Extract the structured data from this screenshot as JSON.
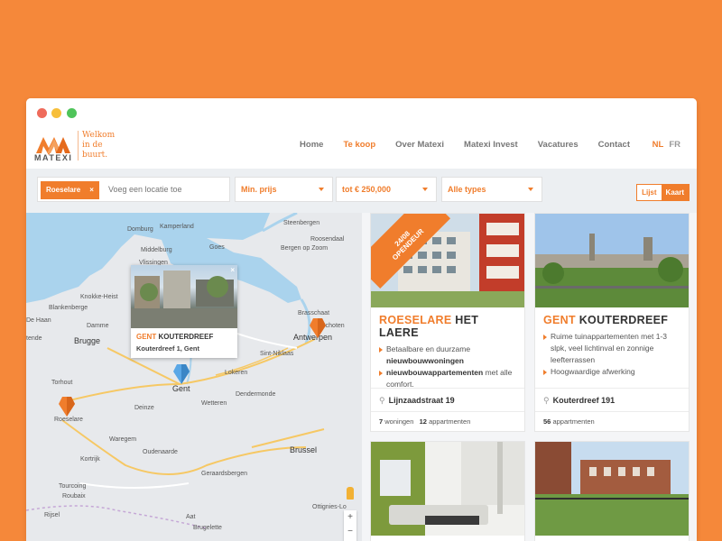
{
  "brand": {
    "name": "MATEXI",
    "tagline": "Welkom in de buurt.",
    "accent": "#f07d2c",
    "background": "#f5883a"
  },
  "nav": {
    "items": [
      {
        "label": "Home"
      },
      {
        "label": "Te koop"
      },
      {
        "label": "Over Matexi"
      },
      {
        "label": "Matexi Invest"
      },
      {
        "label": "Vacatures"
      },
      {
        "label": "Contact"
      }
    ],
    "active": "Te koop",
    "lang_nl": "NL",
    "lang_fr": "FR"
  },
  "filters": {
    "chip_label": "Roeselare",
    "chip_remove": "×",
    "search_placeholder": "Voeg een locatie toe",
    "min_price": "Min. prijs",
    "max_price": "tot € 250,000",
    "types": "Alle types",
    "view_list": "Lijst",
    "view_map": "Kaart"
  },
  "map": {
    "cities": [
      {
        "name": "Domburg"
      },
      {
        "name": "Kamperland"
      },
      {
        "name": "Middelburg"
      },
      {
        "name": "Goes"
      },
      {
        "name": "Steenbergen"
      },
      {
        "name": "Roosendaal"
      },
      {
        "name": "Vlissingen"
      },
      {
        "name": "Bergen op Zoom"
      },
      {
        "name": "Knokke-Heist"
      },
      {
        "name": "Blankenberge"
      },
      {
        "name": "De Haan"
      },
      {
        "name": "Damme"
      },
      {
        "name": "tende"
      },
      {
        "name": "Brugge"
      },
      {
        "name": "Sint-Niklaas"
      },
      {
        "name": "Brasschaat"
      },
      {
        "name": "Schoten"
      },
      {
        "name": "Antwerpen"
      },
      {
        "name": "Lokeren"
      },
      {
        "name": "Torhout"
      },
      {
        "name": "Gent"
      },
      {
        "name": "Dendermonde"
      },
      {
        "name": "Roeselare"
      },
      {
        "name": "Deinze"
      },
      {
        "name": "Wetteren"
      },
      {
        "name": "Waregem"
      },
      {
        "name": "Oudenaarde"
      },
      {
        "name": "Kortrijk"
      },
      {
        "name": "Brussel"
      },
      {
        "name": "Geraardsbergen"
      },
      {
        "name": "Tourcoing"
      },
      {
        "name": "Roubaix"
      },
      {
        "name": "Rijsel"
      },
      {
        "name": "Aat"
      },
      {
        "name": "Brugelette"
      },
      {
        "name": "Ottignies-Lo"
      }
    ],
    "popup": {
      "city": "GENT",
      "name": "KOUTERDREEF",
      "address": "Kouterdreef 1, Gent",
      "close": "×"
    },
    "zoom_in": "+",
    "zoom_out": "−"
  },
  "listings": [
    {
      "city": "ROESELARE",
      "name": "HET LAERE",
      "ribbon": "24/08 OPENDEUR",
      "bullets": [
        {
          "pre": "Betaalbare en duurzame ",
          "bold": "nieuwbouwwoningen",
          "post": ""
        },
        {
          "pre": "",
          "bold": "nieuwbouwappartementen",
          "post": " met alle comfort."
        }
      ],
      "address": "Lijnzaadstraat 19",
      "stat1_num": "7",
      "stat1_label": "woningen",
      "stat2_num": "12",
      "stat2_label": "appartmenten"
    },
    {
      "city": "GENT",
      "name": "KOUTERDREEF",
      "bullets": [
        {
          "pre": "Ruime tuinappartementen met 1-3 slpk, veel lichtinval en zonnige leefterrassen",
          "bold": "",
          "post": ""
        },
        {
          "pre": "Hoogwaardige afwerking",
          "bold": "",
          "post": ""
        }
      ],
      "address": "Kouterdreef 191",
      "stat1_num": "56",
      "stat1_label": "appartmenten"
    }
  ]
}
